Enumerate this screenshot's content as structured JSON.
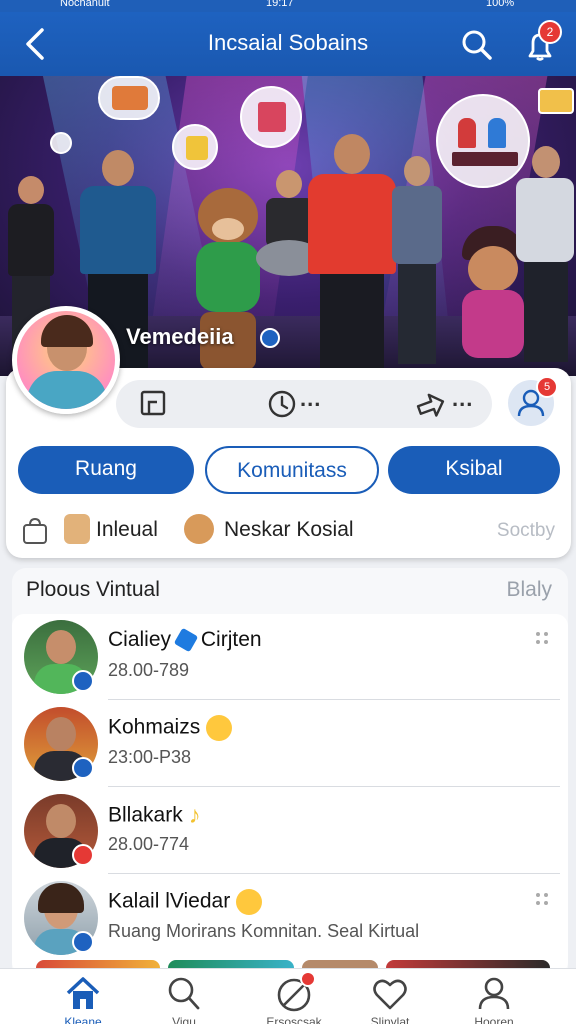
{
  "status_bar": {
    "carrier": "Nochanuit",
    "time": "19:17",
    "battery": "100%"
  },
  "header": {
    "title": "Incsaial Sobains",
    "notification_count": "2"
  },
  "banner": {
    "name": "Vemedeiia"
  },
  "toolbar": {
    "dots_1": "...",
    "dots_2": "...",
    "user_badge": "5"
  },
  "buttons": {
    "ruang": "Ruang",
    "komunitas": "Komunitass",
    "ksibal": "Ksibal"
  },
  "info": {
    "item1": "Inleual",
    "item2": "Neskar Kosial",
    "muted": "Soctby"
  },
  "section": {
    "title": "Ploous Vintual",
    "action": "Blaly"
  },
  "list": [
    {
      "name": "Cialiey",
      "name_suffix": "Cirjten",
      "sub": "28.00-789"
    },
    {
      "name": "Kohmaizs",
      "sub": "23:00-P38"
    },
    {
      "name": "Bllakark",
      "sub": "28.00-774"
    },
    {
      "name": "Kalail lViedar",
      "sub": "Ruang Morirans Komnitan. Sеal Kirtual"
    }
  ],
  "nav": [
    {
      "label": "Kleane",
      "icon": "home-icon"
    },
    {
      "label": "Vigu",
      "icon": "search-icon"
    },
    {
      "label": "Ersoscsak",
      "icon": "compass-icon",
      "badge": ""
    },
    {
      "label": "Slinylat",
      "icon": "heart-icon"
    },
    {
      "label": "Hooren",
      "icon": "profile-icon"
    }
  ],
  "colors": {
    "brand": "#1a5db8",
    "badge": "#e53935"
  }
}
